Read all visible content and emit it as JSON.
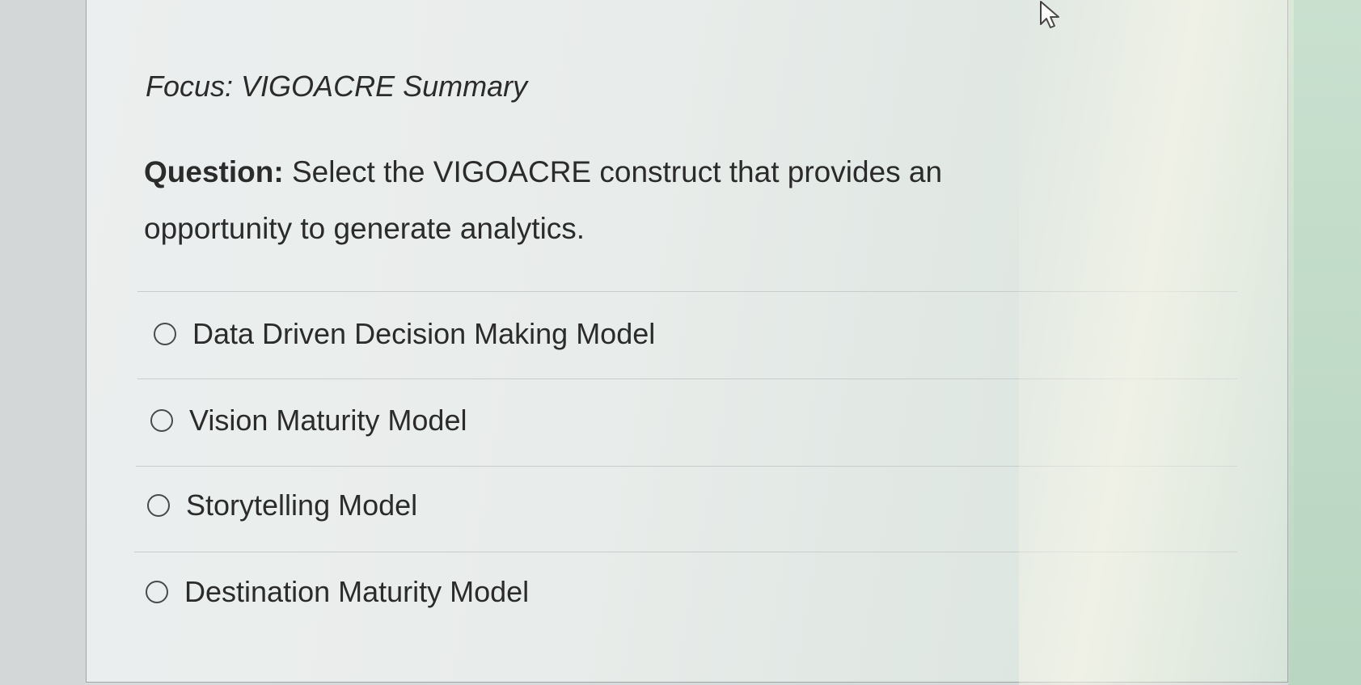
{
  "quiz": {
    "focus_title": "Focus: VIGOACRE Summary",
    "question_label": "Question:",
    "question_text": " Select the VIGOACRE construct that provides an opportunity to generate analytics.",
    "options": [
      {
        "label": "Data Driven Decision Making Model",
        "selected": false
      },
      {
        "label": "Vision Maturity Model",
        "selected": false
      },
      {
        "label": "Storytelling Model",
        "selected": false
      },
      {
        "label": "Destination Maturity Model",
        "selected": false
      }
    ]
  },
  "icons": {
    "radio": "radio-unchecked-icon",
    "cursor": "mouse-pointer-icon"
  },
  "colors": {
    "text": "#2b2b2b",
    "card_background": "#ecefef",
    "divider": "#c8cccc"
  }
}
